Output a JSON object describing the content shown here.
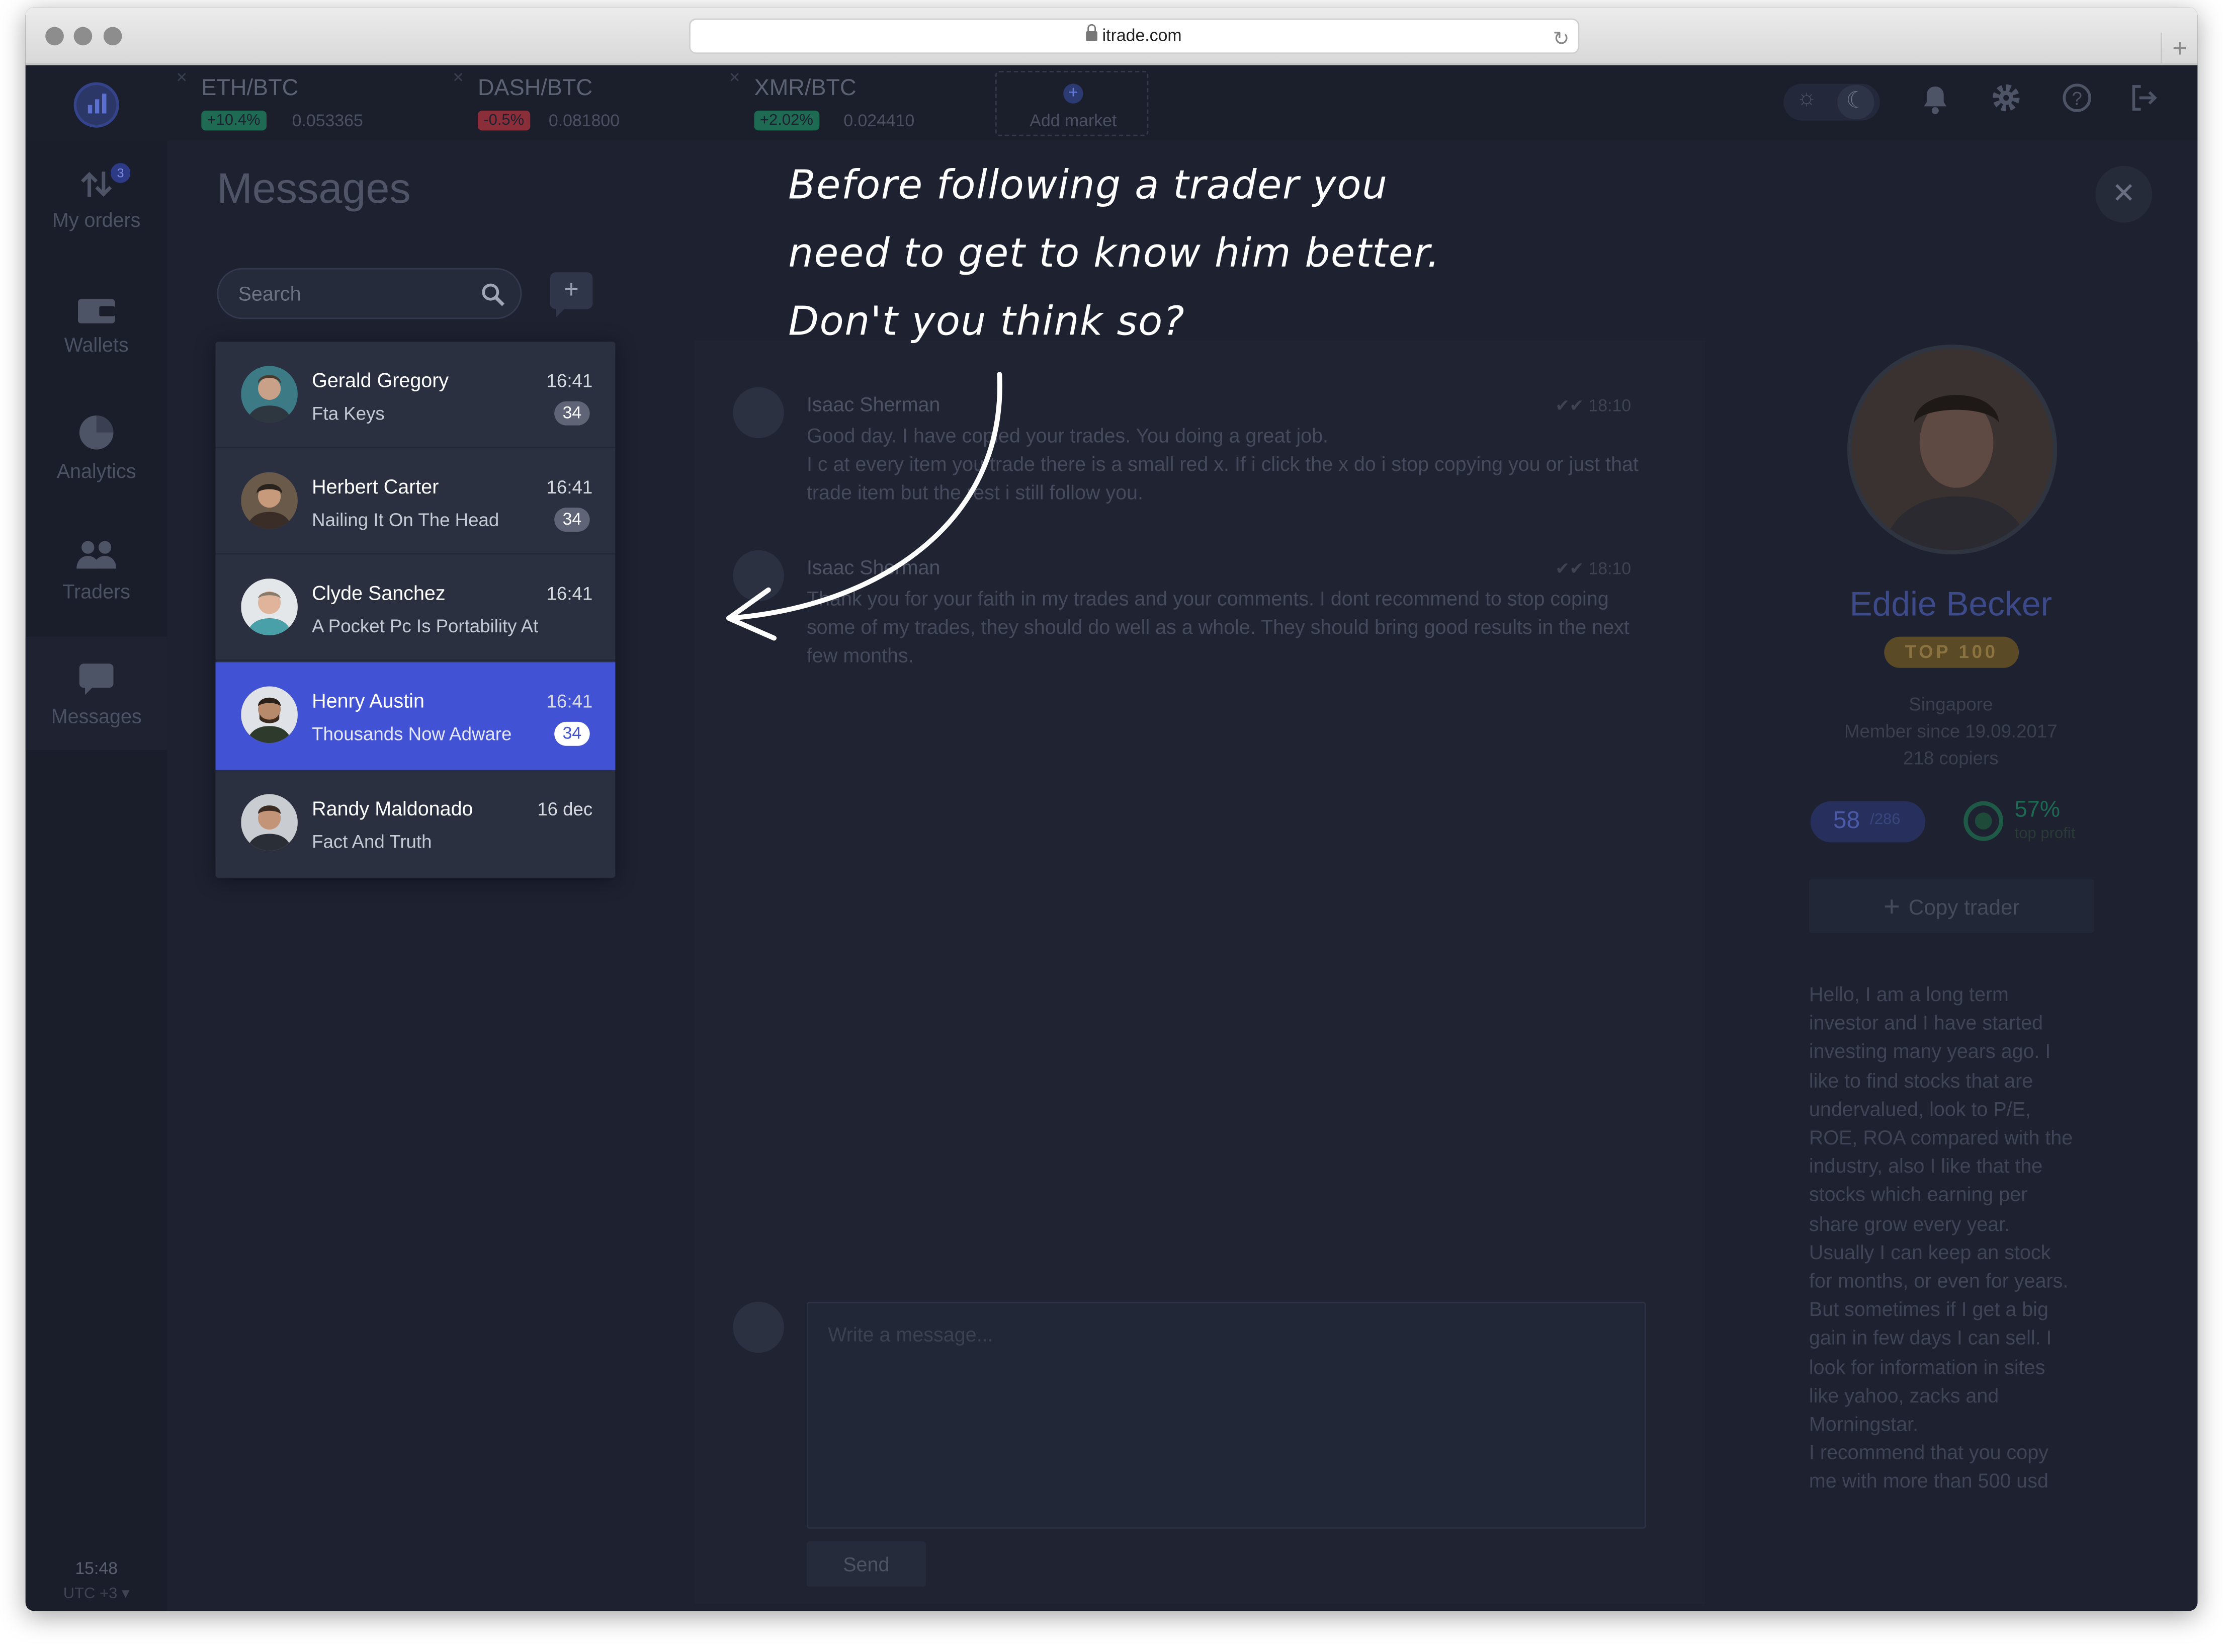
{
  "browser": {
    "url": "itrade.com"
  },
  "markets": [
    {
      "name": "ETH/BTC",
      "change": "+10.4%",
      "price": "0.053365",
      "color": "#1f6a52"
    },
    {
      "name": "DASH/BTC",
      "change": "-0.5%",
      "price": "0.081800",
      "color": "#8a2f3a"
    },
    {
      "name": "XMR/BTC",
      "change": "+2.02%",
      "price": "0.024410",
      "color": "#1f6a52"
    }
  ],
  "add_market": "Add market",
  "sidebar": {
    "orders_badge": "3",
    "items": [
      {
        "label": "My orders"
      },
      {
        "label": "Wallets"
      },
      {
        "label": "Analytics"
      },
      {
        "label": "Traders"
      },
      {
        "label": "Messages"
      }
    ],
    "clock": "15:48",
    "timezone": "UTC +3 ▾"
  },
  "messages": {
    "title": "Messages",
    "search_placeholder": "Search",
    "conversations": [
      {
        "name": "Gerald Gregory",
        "preview": "Fta Keys",
        "time": "16:41",
        "count": "34"
      },
      {
        "name": "Herbert Carter",
        "preview": "Nailing It On The Head",
        "time": "16:41",
        "count": "34"
      },
      {
        "name": "Clyde Sanchez",
        "preview": "A Pocket Pc Is Portability At",
        "time": "16:41"
      },
      {
        "name": "Henry Austin",
        "preview": "Thousands Now Adware",
        "time": "16:41",
        "count": "34"
      },
      {
        "name": "Randy Maldonado",
        "preview": "Fact And Truth",
        "time": "16 dec"
      }
    ]
  },
  "chat": {
    "messages": [
      {
        "sender": "Isaac Sherman",
        "time": "18:10",
        "text": "Good day. I have copied your trades. You doing a great job.\nI c at every item you trade there is a small red x. If i click the x do i stop copying you or just that trade item but the rest i still follow you."
      },
      {
        "sender": "Isaac Sherman",
        "time": "18:10",
        "text": "Thank you for your faith in my trades and your comments. I dont recommend to stop coping some of my trades, they should do well as a whole. They should bring good results in the next few months."
      }
    ],
    "compose_placeholder": "Write a message...",
    "send_label": "Send"
  },
  "profile": {
    "name": "Eddie Becker",
    "tag": "TOP 100",
    "location": "Singapore",
    "member_since": "Member since 19.09.2017",
    "copiers": "218 copiers",
    "rank": "58",
    "rank_total": "/286",
    "profit_pct": "57%",
    "profit_label": "top profit",
    "copy_label": "Copy trader",
    "bio": "Hello, I am a long term\ninvestor and I have started\ninvesting many years ago. I\nlike to find stocks that are\nundervalued,  look to P/E,\nROE, ROA compared with the\nindustry, also I like that the\nstocks which earning per\nshare grow every year.\nUsually I can keep an stock\nfor months, or even for years.\nBut sometimes if I get a big\ngain in few days I can sell.  I\nlook for information in sites\nlike yahoo, zacks and\nMorningstar.\nI recommend that you copy\nme with more than 500 usd"
  },
  "annotation": "Before following a trader you\nneed to get to know him better.\nDon't you think so?"
}
